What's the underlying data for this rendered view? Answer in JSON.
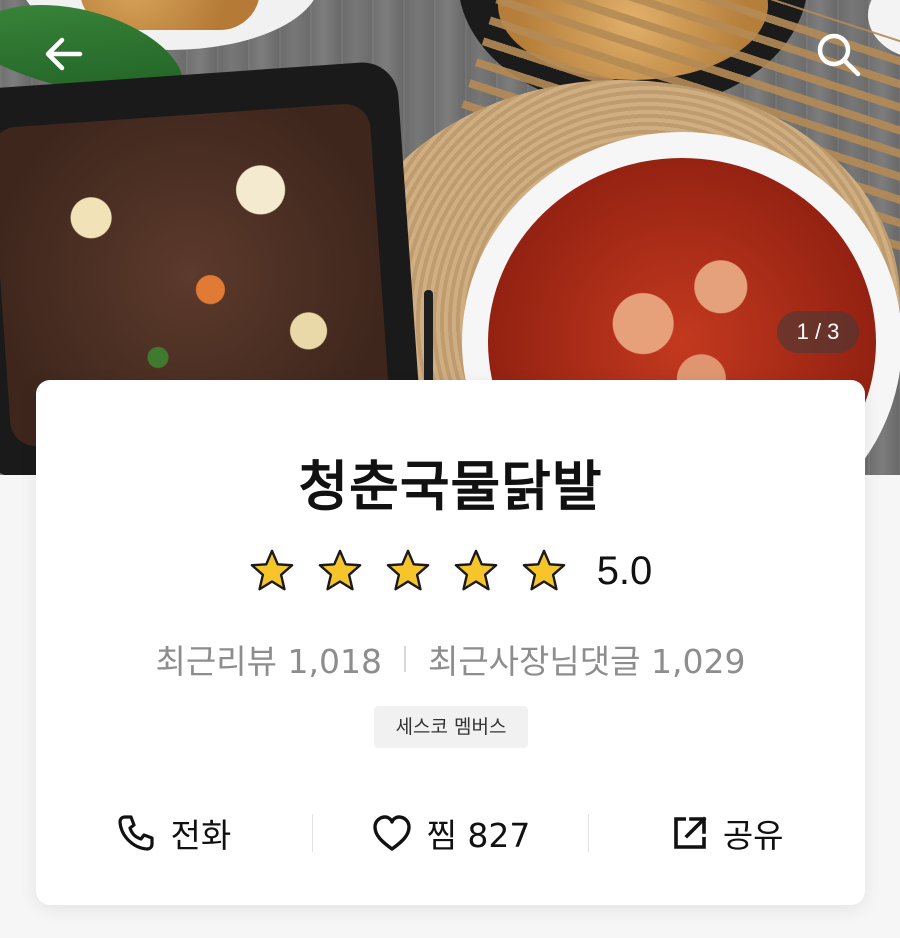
{
  "header": {
    "back_icon": "arrow-left-icon",
    "search_icon": "search-icon"
  },
  "gallery": {
    "page_indicator": "1 / 3",
    "current_page": 1,
    "total_pages": 3
  },
  "store": {
    "name": "청춘국물닭발",
    "rating": 5.0,
    "rating_text": "5.0",
    "stars_filled": 5,
    "stars_total": 5,
    "star_color": "#f6c52b",
    "recent_reviews": "최근리뷰 1,018",
    "recent_owner_comments": "최근사장님댓글 1,029",
    "badge": "세스코 멤버스"
  },
  "actions": {
    "call": {
      "label": "전화",
      "icon": "phone-icon"
    },
    "favorite": {
      "label": "찜 827",
      "icon": "heart-icon"
    },
    "share": {
      "label": "공유",
      "icon": "share-icon"
    }
  }
}
